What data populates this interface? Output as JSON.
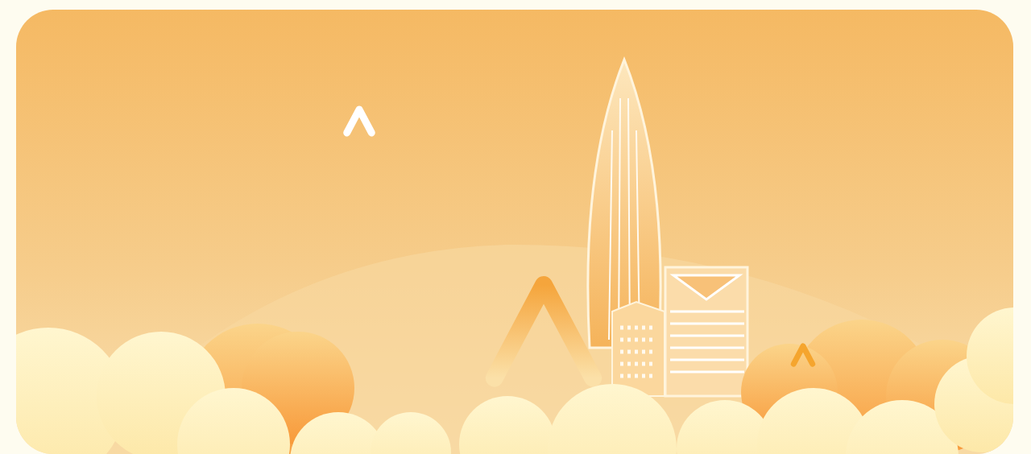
{
  "banner": {
    "kind": "illustration"
  }
}
